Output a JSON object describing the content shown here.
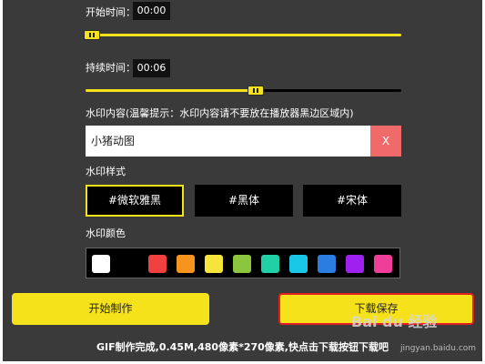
{
  "start_time": {
    "label": "开始时间：",
    "value": "00:00",
    "slider_fraction": 0.02
  },
  "duration": {
    "label": "持续时间：",
    "value": "00:06",
    "slider_fraction": 0.54
  },
  "watermark_content": {
    "label": "水印内容(温馨提示：水印内容请不要放在播放器黑边区域内)",
    "value": "小猪动图",
    "clear_label": "X"
  },
  "watermark_style": {
    "label": "水印样式",
    "options": [
      "#微软雅黑",
      "#黑体",
      "#宋体"
    ],
    "selected": "#微软雅黑"
  },
  "watermark_color": {
    "label": "水印颜色",
    "colors": [
      "#ffffff",
      "#000000",
      "#f04040",
      "#f7941d",
      "#f5e43a",
      "#8cc63e",
      "#1fd1a5",
      "#18c6e6",
      "#2a7de1",
      "#a020f0",
      "#ee3e9a"
    ]
  },
  "actions": {
    "start": "开始制作",
    "download": "下载保存"
  },
  "status_text": "GIF制作完成,0.45M,480像素*270像素,快点击下载按钮下载吧",
  "accent": "#f5e21b",
  "baidu_watermark": {
    "brand": "Bai du 经验",
    "url": "jingyan.baidu.com"
  }
}
